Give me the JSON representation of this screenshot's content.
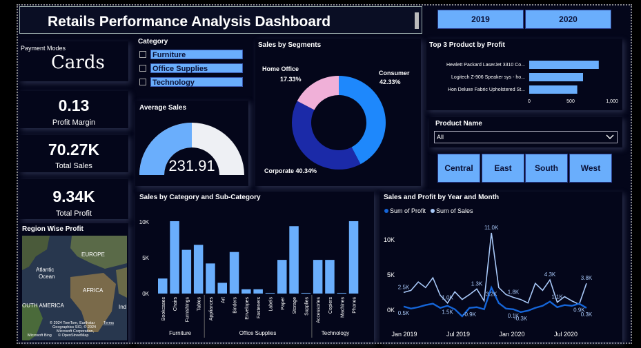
{
  "title": "Retails Performance Analysis Dashboard",
  "years": [
    "2019",
    "2020"
  ],
  "payment": {
    "label": "Payment Modes",
    "value": "Cards"
  },
  "category": {
    "label": "Category",
    "items": [
      "Furniture",
      "Office Supplies",
      "Technology"
    ]
  },
  "kpis": [
    {
      "value": "0.13",
      "label": "Profit Margin"
    },
    {
      "value": "70.27K",
      "label": "Total Sales"
    },
    {
      "value": "9.34K",
      "label": "Total Profit"
    }
  ],
  "avg_sales": {
    "label": "Average Sales",
    "value": "231.91",
    "fraction": 0.5
  },
  "segments": {
    "label": "Sales by Segments",
    "home": "Home Office",
    "home_pct": "17.33%",
    "consumer": "Consumer",
    "consumer_pct": "42.33%",
    "corporate": "Corporate 40.34%"
  },
  "top3": {
    "label": "Top 3 Product by Profit"
  },
  "product_filter": {
    "label": "Product Name",
    "value": "All"
  },
  "regions": [
    "Central",
    "East",
    "South",
    "West"
  ],
  "map": {
    "label": "Region Wise Profit",
    "europe": "EUROPE",
    "atlantic": "Atlantic",
    "ocean": "Ocean",
    "africa": "AFRICA",
    "sa": "OUTH AMERICA",
    "ind": "Ind",
    "copyright1": "© 2024 TomTom, Earthstar",
    "copyright2": "Geographics SIO, © 2024",
    "copyright3": "Microsoft Corporation,",
    "copyright4": "© OpenStreetMap",
    "terms": "Terms",
    "bing": "Microsoft Bing"
  },
  "subcat_title": "Sales by Category and Sub-Category",
  "trend_title": "Sales and Profit by Year and Month",
  "trend_legend": [
    "Sum of Profit",
    "Sum of Sales"
  ],
  "colors": {
    "accent": "#6aaefc",
    "consumer": "#1e88fc",
    "corporate": "#1b2aa8",
    "home": "#f0b0d8",
    "bg": "#04061a",
    "profit": "#1565d8",
    "sales": "#a8c8f8"
  },
  "chart_data": [
    {
      "type": "bar",
      "orientation": "horizontal",
      "title": "Top 3 Product by Profit",
      "categories": [
        "Hewlett Packard LaserJet 3310 Co...",
        "Logitech Z-906 Speaker sys - ho...",
        "Hon Deluxe Fabric Upholstered St..."
      ],
      "values": [
        840,
        650,
        580
      ],
      "xlim": [
        0,
        1000
      ],
      "xticks": [
        "0",
        "500",
        "1,000"
      ]
    },
    {
      "type": "pie",
      "title": "Sales by Segments",
      "slices": [
        {
          "label": "Consumer",
          "value": 42.33
        },
        {
          "label": "Corporate",
          "value": 40.34
        },
        {
          "label": "Home Office",
          "value": 17.33
        }
      ]
    },
    {
      "type": "bar",
      "title": "Sales by Category and Sub-Category",
      "ylim": [
        0,
        10000
      ],
      "yticks": [
        "0K",
        "5K",
        "10K"
      ],
      "groups": [
        {
          "name": "Furniture",
          "categories": [
            "Bookcases",
            "Chairs",
            "Furnishings",
            "Tables"
          ],
          "values": [
            2100,
            10100,
            6100,
            6800
          ]
        },
        {
          "name": "Office Supplies",
          "categories": [
            "Appliances",
            "Art",
            "Binders",
            "Envelopes",
            "Fasteners",
            "Labels",
            "Paper",
            "Storage",
            "Supplies"
          ],
          "values": [
            4200,
            1500,
            5800,
            600,
            600,
            100,
            4700,
            9400,
            100
          ]
        },
        {
          "name": "Technology",
          "categories": [
            "Accessories",
            "Copiers",
            "Machines",
            "Phones"
          ],
          "values": [
            4700,
            4700,
            100,
            10100
          ]
        }
      ]
    },
    {
      "type": "line",
      "title": "Sales and Profit by Year and Month",
      "ylim": [
        -1000,
        11000
      ],
      "yticks": [
        "0K",
        "5K",
        "10K"
      ],
      "xticks": [
        "Jan 2019",
        "Jul 2019",
        "Jan 2020",
        "Jul 2020"
      ],
      "series": [
        {
          "name": "Sum of Sales",
          "values": [
            2500,
            2800,
            4000,
            3200,
            4600,
            2100,
            1000,
            2600,
            1500,
            2200,
            3000,
            1300,
            11000,
            3200,
            2200,
            1800,
            1500,
            1000,
            3800,
            2800,
            4300,
            1100,
            1900,
            1300,
            800,
            3800
          ]
        },
        {
          "name": "Sum of Profit",
          "values": [
            500,
            200,
            400,
            700,
            900,
            300,
            600,
            100,
            -900,
            300,
            400,
            100,
            3200,
            1000,
            200,
            100,
            -300,
            -100,
            300,
            600,
            1200,
            400,
            700,
            600,
            900,
            300
          ]
        }
      ],
      "labels": {
        "sales": [
          "2.5K",
          "1.0K",
          "1.3K",
          "11.0K",
          "1.8K",
          "4.3K",
          "1.1K",
          "3.8K"
        ],
        "profit": [
          "0.5K",
          "1.5K",
          "-0.9K",
          "3.2K",
          "0.1K",
          "-0.3K",
          "0.9K",
          "0.3K"
        ]
      }
    }
  ]
}
